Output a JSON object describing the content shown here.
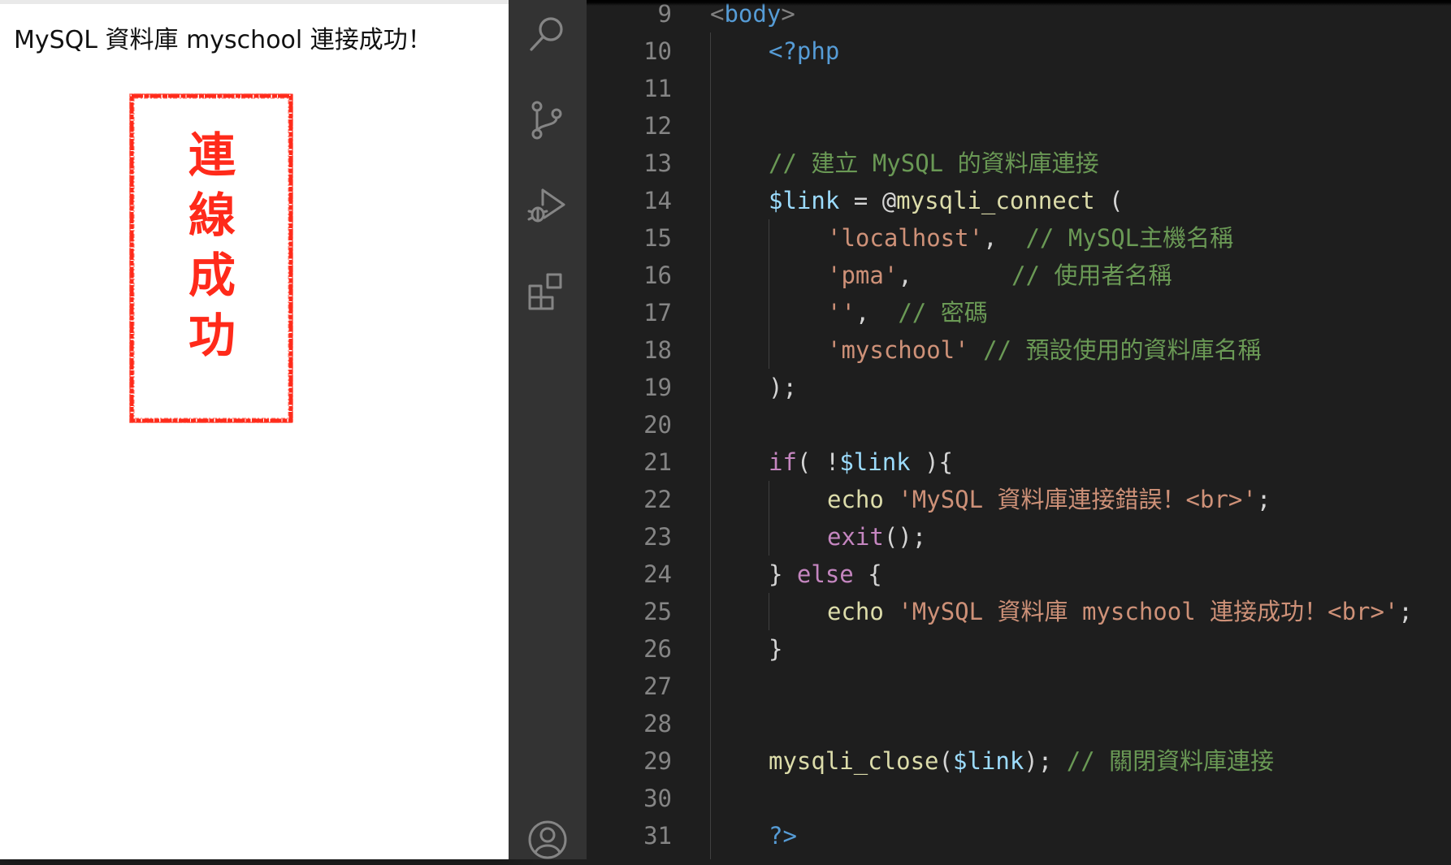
{
  "browser": {
    "output_text": "MySQL 資料庫 myschool 連接成功！",
    "stamp": {
      "chars": [
        "連",
        "線",
        "成",
        "功"
      ],
      "color": "#ff2a1a"
    }
  },
  "activity_bar": {
    "icons": [
      "search-icon",
      "source-control-icon",
      "run-debug-icon",
      "extensions-icon",
      "account-icon"
    ]
  },
  "editor": {
    "line_numbers": [
      "9",
      "10",
      "11",
      "12",
      "13",
      "14",
      "15",
      "16",
      "17",
      "18",
      "19",
      "20",
      "21",
      "22",
      "23",
      "24",
      "25",
      "26",
      "27",
      "28",
      "29",
      "30",
      "31"
    ],
    "code": {
      "l9_open": "<",
      "l9_tag": "body",
      "l9_close": ">",
      "l10": "<?php",
      "l13": "// 建立 MySQL 的資料庫連接",
      "l14_var": "$link",
      "l14_op": " = @",
      "l14_fn": "mysqli_connect",
      "l14_paren": " (",
      "l15_str": "'localhost'",
      "l15_comma": ",  ",
      "l15_cmt": "// MySQL主機名稱",
      "l16_str": "'pma'",
      "l16_comma": ",       ",
      "l16_cmt": "// 使用者名稱",
      "l17_str": "''",
      "l17_comma": ",  ",
      "l17_cmt": "// 密碼",
      "l18_str": "'myschool'",
      "l18_sp": " ",
      "l18_cmt": "// 預設使用的資料庫名稱",
      "l19": ");",
      "l21_kw": "if",
      "l21_p1": "( !",
      "l21_var": "$link",
      "l21_p2": " ){",
      "l22_fn": "echo",
      "l22_sp": " ",
      "l22_str": "'MySQL 資料庫連接錯誤！<br>'",
      "l22_end": ";",
      "l23_kw": "exit",
      "l23_end": "();",
      "l24_b1": "} ",
      "l24_kw": "else",
      "l24_b2": " {",
      "l25_fn": "echo",
      "l25_sp": " ",
      "l25_str": "'MySQL 資料庫 myschool 連接成功！<br>'",
      "l25_end": ";",
      "l26": "}",
      "l29_fn": "mysqli_close",
      "l29_p1": "(",
      "l29_var": "$link",
      "l29_p2": "); ",
      "l29_cmt": "// 關閉資料庫連接",
      "l31": "?>"
    }
  },
  "colors": {
    "editor_bg": "#1e1e1e",
    "activity_bar_bg": "#333333",
    "tag": "#569cd6",
    "comment": "#6a9955",
    "variable": "#9cdcfe",
    "function": "#dcdcaa",
    "string": "#ce9178",
    "keyword": "#c586c0",
    "line_number": "#858585"
  }
}
